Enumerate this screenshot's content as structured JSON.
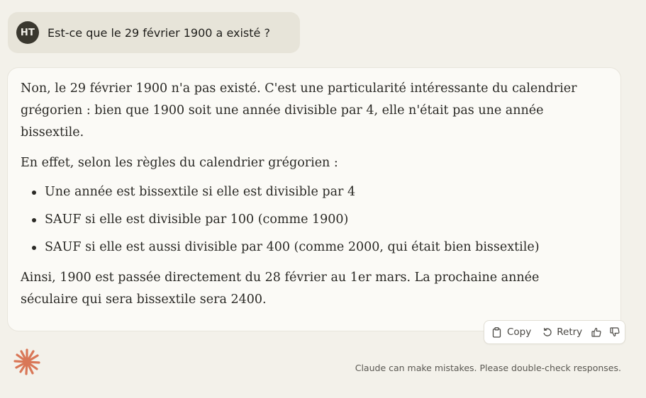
{
  "user_message": {
    "avatar_initials": "HT",
    "text": "Est-ce que le 29 février 1900 a existé ?"
  },
  "assistant_message": {
    "paragraphs": [
      "Non, le 29 février 1900 n'a pas existé. C'est une particularité intéressante du calendrier grégorien : bien que 1900 soit une année divisible par 4, elle n'était pas une année bissextile.",
      "En effet, selon les règles du calendrier grégorien :",
      "Ainsi, 1900 est passée directement du 28 février au 1er mars. La prochaine année séculaire qui sera bissextile sera 2400."
    ],
    "bullets": [
      "Une année est bissextile si elle est divisible par 4",
      "SAUF si elle est divisible par 100 (comme 1900)",
      "SAUF si elle est aussi divisible par 400 (comme 2000, qui était bien bissextile)"
    ]
  },
  "actions": {
    "copy_label": "Copy",
    "retry_label": "Retry",
    "copy_icon": "clipboard-icon",
    "retry_icon": "retry-icon",
    "thumbs_up_icon": "thumbs-up-icon",
    "thumbs_down_icon": "thumbs-down-icon"
  },
  "footer": {
    "disclaimer": "Claude can make mistakes. Please double-check responses.",
    "logo_icon": "claude-starburst-logo"
  },
  "colors": {
    "background": "#f3f1ea",
    "user_bubble": "#e7e4d9",
    "assistant_card": "#fbfaf6",
    "avatar": "#3a382f",
    "logo_accent": "#d97757"
  }
}
